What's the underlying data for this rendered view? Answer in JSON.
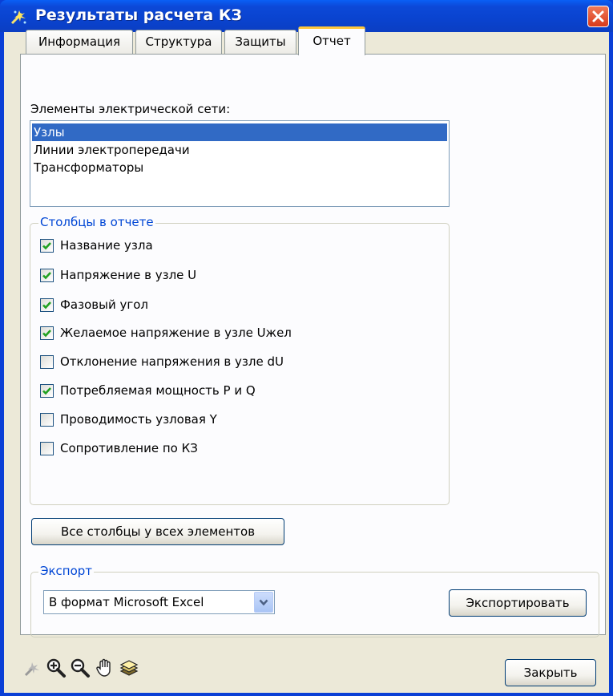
{
  "window": {
    "title": "Результаты расчета КЗ",
    "title_color": "#ffffff",
    "accent": "#0a3fd6"
  },
  "tabs": [
    {
      "label": "Информация",
      "active": false
    },
    {
      "label": "Структура",
      "active": false
    },
    {
      "label": "Защиты",
      "active": false
    },
    {
      "label": "Отчет",
      "active": true
    }
  ],
  "elements": {
    "label": "Элементы электрической сети:",
    "items": [
      {
        "label": "Узлы",
        "selected": true
      },
      {
        "label": "Линии электропередачи",
        "selected": false
      },
      {
        "label": "Трансформаторы",
        "selected": false
      }
    ]
  },
  "columns": {
    "legend": "Столбцы в отчете",
    "items": [
      {
        "label": "Название узла",
        "checked": true
      },
      {
        "label": "Напряжение в узле U",
        "checked": true
      },
      {
        "label": "Фазовый угол",
        "checked": true
      },
      {
        "label": "Желаемое напряжение в узле Uжел",
        "checked": true
      },
      {
        "label": "Отклонение напряжения в узле dU",
        "checked": false
      },
      {
        "label": "Потребляемая мощность P и Q",
        "checked": true
      },
      {
        "label": "Проводимость узловая Y",
        "checked": false
      },
      {
        "label": "Сопротивление по КЗ",
        "checked": false
      }
    ]
  },
  "all_columns_button": "Все столбцы у всех элементов",
  "export": {
    "legend": "Экспорт",
    "format_selected": "В формат Microsoft Excel",
    "export_button": "Экспортировать"
  },
  "toolbar": {
    "icons": [
      "pointer-icon",
      "zoom-in-icon",
      "zoom-out-icon",
      "pan-hand-icon",
      "layers-icon"
    ]
  },
  "close_button": "Закрыть"
}
